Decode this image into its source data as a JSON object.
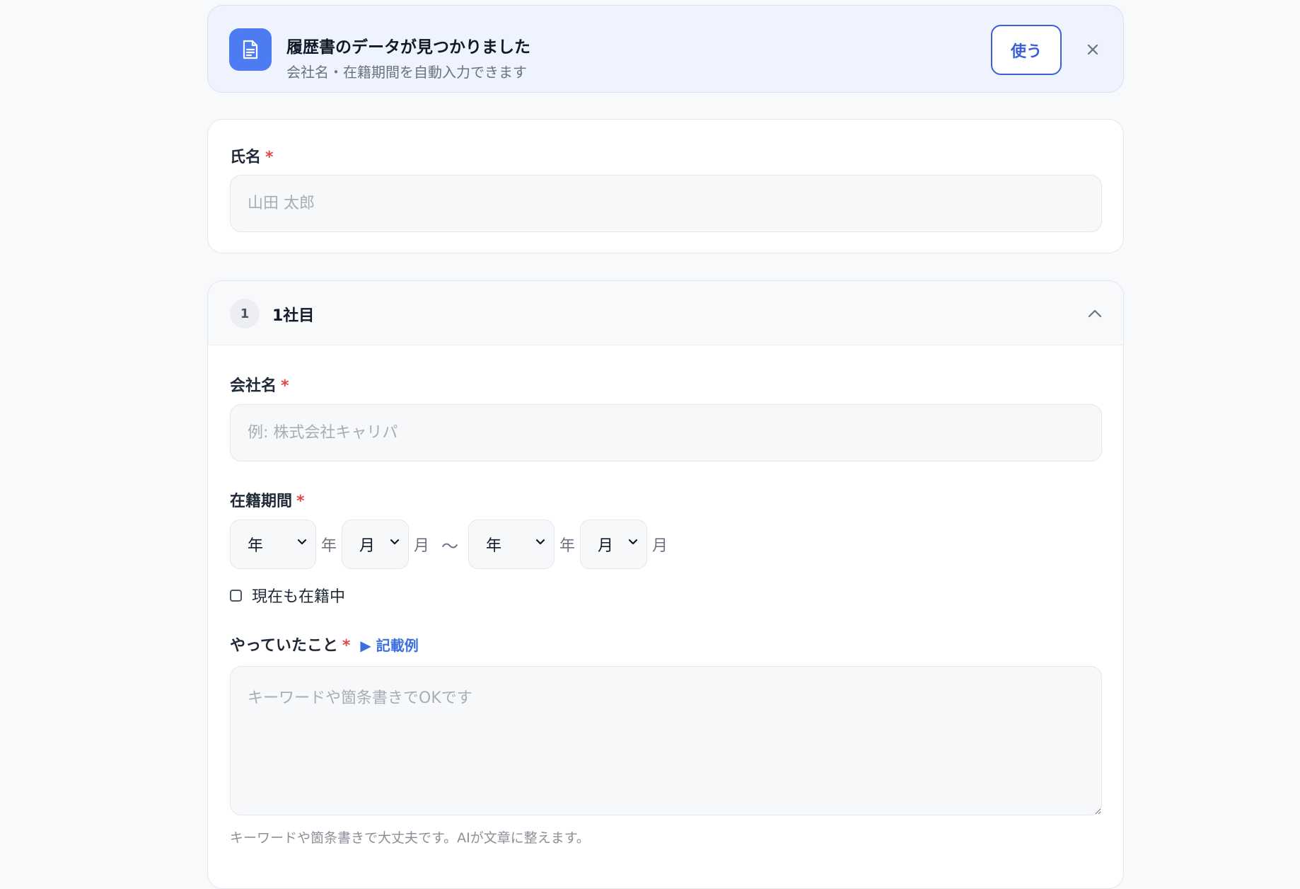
{
  "banner": {
    "title": "履歴書のデータが見つかりました",
    "subtitle": "会社名・在籍期間を自動入力できます",
    "use_label": "使う",
    "accent": "#4c7cf0"
  },
  "name_field": {
    "label": "氏名",
    "required_mark": "*",
    "placeholder": "山田 太郎",
    "value": ""
  },
  "company": {
    "number": "1",
    "title": "1社目",
    "company_name": {
      "label": "会社名",
      "required_mark": "*",
      "placeholder": "例: 株式会社キャリパ",
      "value": ""
    },
    "period": {
      "label": "在籍期間",
      "required_mark": "*",
      "start_year": "年",
      "start_year_unit": "年",
      "start_month": "月",
      "start_month_unit": "月",
      "separator": "〜",
      "end_year": "年",
      "end_year_unit": "年",
      "end_month": "月",
      "end_month_unit": "月"
    },
    "current": {
      "label": "現在も在籍中",
      "checked": false
    },
    "duties": {
      "label": "やっていたこと",
      "required_mark": "*",
      "example_link": "▶ 記載例",
      "placeholder": "キーワードや箇条書きでOKです",
      "hint": "キーワードや箇条書きで大丈夫です。AIが文章に整えます。"
    }
  }
}
